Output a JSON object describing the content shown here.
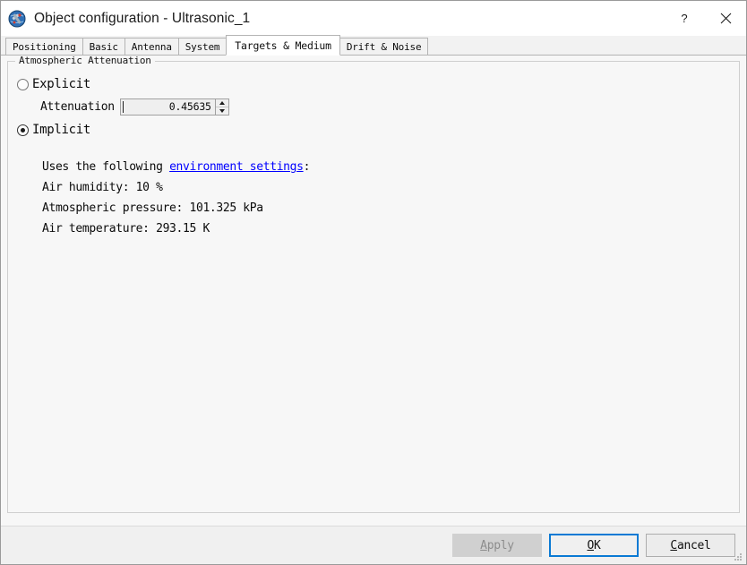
{
  "window": {
    "title": "Object configuration - Ultrasonic_1",
    "icon": "satellite-globe-icon",
    "help_button": "?",
    "close_button": "✕"
  },
  "tabs": [
    {
      "label": "Positioning",
      "selected": false
    },
    {
      "label": "Basic",
      "selected": false
    },
    {
      "label": "Antenna",
      "selected": false
    },
    {
      "label": "System",
      "selected": false
    },
    {
      "label": "Targets & Medium",
      "selected": true
    },
    {
      "label": "Drift & Noise",
      "selected": false
    }
  ],
  "group": {
    "title": "Atmospheric Attenuation"
  },
  "options": {
    "explicit": {
      "label": "Explicit",
      "selected": false
    },
    "implicit": {
      "label": "Implicit",
      "selected": true
    }
  },
  "attenuation": {
    "label": "Attenuation",
    "value": "0.45635"
  },
  "info": {
    "intro_prefix": "Uses the following ",
    "link_text": "environment settings",
    "intro_suffix": ":",
    "humidity": "Air humidity: 10 %",
    "pressure": "Atmospheric pressure: 101.325 kPa",
    "temperature": "Air temperature: 293.15 K"
  },
  "footer": {
    "apply": {
      "pre": "",
      "accel": "A",
      "post": "pply",
      "enabled": false
    },
    "ok": {
      "pre": "",
      "accel": "O",
      "post": "K",
      "enabled": true
    },
    "cancel": {
      "pre": "",
      "accel": "C",
      "post": "ancel",
      "enabled": true
    }
  },
  "colors": {
    "link": "#0000ff",
    "focus_border": "#0a7ad4",
    "content_bg": "#f7f7f7",
    "footer_bg": "#f0f0f0"
  }
}
